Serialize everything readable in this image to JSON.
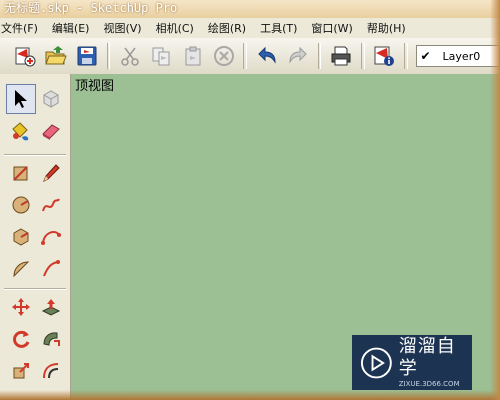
{
  "window": {
    "title": "无标题.skp - SketchUp Pro"
  },
  "menubar": {
    "items": [
      {
        "label": "文件(F)"
      },
      {
        "label": "编辑(E)"
      },
      {
        "label": "视图(V)"
      },
      {
        "label": "相机(C)"
      },
      {
        "label": "绘图(R)"
      },
      {
        "label": "工具(T)"
      },
      {
        "label": "窗口(W)"
      },
      {
        "label": "帮助(H)"
      }
    ]
  },
  "toolbar": {
    "icons": [
      "new-file-icon",
      "open-folder-icon",
      "save-icon",
      "cut-icon",
      "copy-icon",
      "paste-icon",
      "erase-icon",
      "undo-icon",
      "redo-icon",
      "print-icon",
      "model-info-icon"
    ],
    "layer": {
      "checked": "✔",
      "name": "Layer0"
    }
  },
  "left_toolbar": {
    "icons": [
      "select-icon",
      "make-component-icon",
      "paint-bucket-icon",
      "eraser-icon",
      "rectangle-icon",
      "line-icon",
      "circle-icon",
      "arc-icon",
      "polygon-icon",
      "freehand-icon",
      "offset-icon",
      "arc-2-icon",
      "move-icon",
      "push-pull-icon",
      "rotate-icon",
      "follow-me-icon",
      "scale-icon",
      "offset-tool-icon"
    ]
  },
  "viewport": {
    "label": "顶视图",
    "background": "#9cbf94"
  },
  "watermark": {
    "name": "溜溜自学",
    "url": "ZIXUE.3D66.COM"
  }
}
